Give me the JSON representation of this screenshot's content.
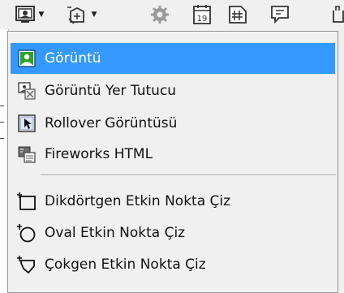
{
  "toolbar": {
    "buttons": [
      {
        "icon": "image-icon",
        "has_dropdown": true
      },
      {
        "icon": "hotspot-tool-icon",
        "has_dropdown": true
      },
      {
        "icon": "gear-icon",
        "has_dropdown": false
      },
      {
        "icon": "calendar-icon",
        "calendar_day": "19"
      },
      {
        "icon": "table-icon",
        "has_dropdown": false
      },
      {
        "icon": "comment-icon",
        "has_dropdown": false
      },
      {
        "icon": "widget-icon",
        "has_dropdown": false
      }
    ]
  },
  "menu": {
    "items": [
      {
        "label": "Görüntü",
        "icon": "image-icon",
        "selected": true
      },
      {
        "label": "Görüntü Yer Tutucu",
        "icon": "image-placeholder-icon",
        "selected": false
      },
      {
        "label": "Rollover Görüntüsü",
        "icon": "rollover-image-icon",
        "selected": false
      },
      {
        "label": "Fireworks HTML",
        "icon": "fireworks-html-icon",
        "selected": false
      },
      {
        "label": "Dikdörtgen Etkin Nokta Çiz",
        "icon": "rectangle-hotspot-icon",
        "selected": false
      },
      {
        "label": "Oval Etkin Nokta Çiz",
        "icon": "oval-hotspot-icon",
        "selected": false
      },
      {
        "label": "Çokgen Etkin Nokta Çiz",
        "icon": "polygon-hotspot-icon",
        "selected": false
      }
    ]
  },
  "colors": {
    "selection": "#3399ff",
    "menu_background": "#f0f0f0",
    "menu_border": "#979797"
  }
}
